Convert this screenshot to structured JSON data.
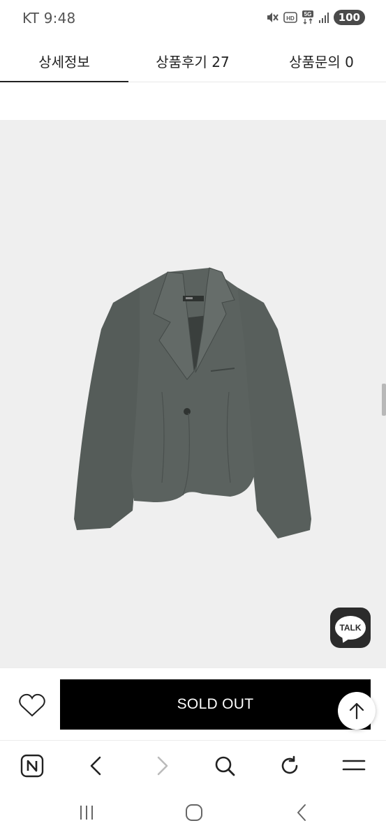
{
  "status_bar": {
    "carrier": "KT",
    "time": "9:48",
    "battery": "100",
    "icons": [
      "mute-icon",
      "hd-icon",
      "5g-icon",
      "signal-icon",
      "battery-icon"
    ]
  },
  "tabs": [
    {
      "label": "상세정보",
      "active": true
    },
    {
      "label": "상품후기 27",
      "active": false
    },
    {
      "label": "상품문의 0",
      "active": false
    }
  ],
  "product": {
    "image_icon": "jacket-image",
    "background_color": "#efefef",
    "jacket_color": "#575e5b"
  },
  "talk_button": {
    "label": "TALK"
  },
  "purchase_bar": {
    "soldout_label": "SOLD OUT",
    "wishlist_icon": "heart-icon",
    "scroll_top_icon": "arrow-up-icon"
  },
  "browser_toolbar": {
    "icons": [
      "naver-home-icon",
      "back-icon",
      "forward-icon",
      "search-icon",
      "refresh-icon",
      "menu-icon"
    ]
  },
  "android_nav": {
    "icons": [
      "recent-apps-icon",
      "home-icon",
      "back-icon"
    ]
  }
}
